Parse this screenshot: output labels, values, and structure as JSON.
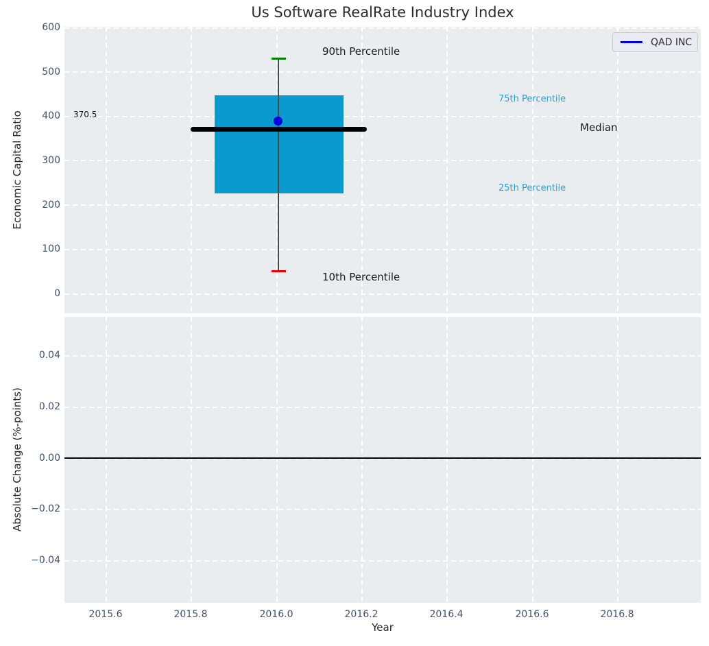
{
  "figure": {
    "title": "Us Software RealRate Industry Index"
  },
  "legend": {
    "label": "QAD INC",
    "line_color": "#0000e0"
  },
  "annotations": {
    "p90": "90th Percentile",
    "p75": "75th Percentile",
    "median": "Median",
    "p25": "25th Percentile",
    "p10": "10th Percentile",
    "median_value_label": "370.5"
  },
  "axes": {
    "top": {
      "ylabel": "Economic Capital Ratio",
      "yticks": [
        "600",
        "500",
        "400",
        "300",
        "200",
        "100",
        "0"
      ]
    },
    "bottom": {
      "ylabel": "Absolute Change (%-points)",
      "yticks": [
        "0.04",
        "0.02",
        "0.00",
        "−0.02",
        "−0.04"
      ],
      "xlabel": "Year",
      "xticks": [
        "2015.6",
        "2015.8",
        "2016.0",
        "2016.2",
        "2016.4",
        "2016.6",
        "2016.8"
      ]
    }
  },
  "colors": {
    "box_fill": "#0a9bce",
    "whisker": "#4a4a4a",
    "cap_top": "#007f00",
    "cap_bottom": "#e60000",
    "median_line": "#000000",
    "marker": "#0000e0",
    "percentile_text": "#2a9fd0",
    "axes_background": "#e9edef",
    "tick_text": "#41536a"
  },
  "chart_data": [
    {
      "type": "boxplot",
      "title": "Us Software RealRate Industry Index",
      "xlabel": "Year",
      "ylabel": "Economic Capital Ratio",
      "xlim": [
        2015.5,
        2017.0
      ],
      "ylim": [
        -45,
        602
      ],
      "yticks": [
        0,
        100,
        200,
        300,
        400,
        500,
        600
      ],
      "grid": true,
      "legend_position": "upper right",
      "legend": [
        "QAD INC"
      ],
      "boxes": [
        {
          "x": 2016.0,
          "box_x_range": [
            2015.85,
            2016.15
          ],
          "p10": 48,
          "p25": 225,
          "median": 370.5,
          "p75": 447,
          "p90": 530,
          "median_line_x_range": [
            2015.8,
            2016.2
          ]
        }
      ],
      "series": [
        {
          "name": "QAD INC",
          "type": "scatter",
          "x": [
            2016.0
          ],
          "y": [
            388
          ],
          "color": "#0000e0"
        }
      ],
      "annotations": [
        {
          "text": "90th Percentile",
          "near_value": 530
        },
        {
          "text": "75th Percentile",
          "near_value": 447
        },
        {
          "text": "Median",
          "near_value": 370.5
        },
        {
          "text": "370.5",
          "near_value": 370.5
        },
        {
          "text": "25th Percentile",
          "near_value": 225
        },
        {
          "text": "10th Percentile",
          "near_value": 48
        }
      ]
    },
    {
      "type": "line",
      "xlabel": "Year",
      "ylabel": "Absolute Change (%-points)",
      "xticks": [
        2015.6,
        2015.8,
        2016.0,
        2016.2,
        2016.4,
        2016.6,
        2016.8
      ],
      "yticks": [
        0.04,
        0.02,
        0.0,
        -0.02,
        -0.04
      ],
      "ylim": [
        -0.056,
        0.055
      ],
      "grid": true,
      "series": [],
      "zero_line": 0.0
    }
  ]
}
